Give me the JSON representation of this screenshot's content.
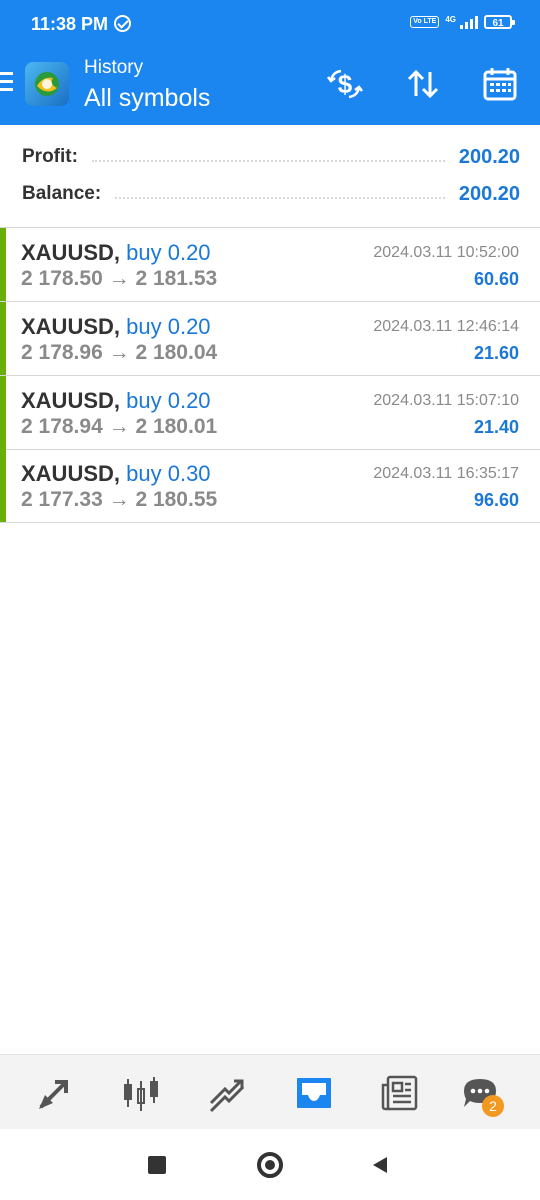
{
  "status_bar": {
    "time": "11:38 PM",
    "volte": "Vo LTE",
    "network": "4G",
    "battery": "61"
  },
  "header": {
    "subtitle": "History",
    "title": "All symbols"
  },
  "summary": {
    "profit_label": "Profit:",
    "profit_value": "200.20",
    "balance_label": "Balance:",
    "balance_value": "200.20"
  },
  "trades": [
    {
      "symbol": "XAUUSD,",
      "side": "buy 0.20",
      "open": "2 178.50",
      "arrow": "→",
      "close": "2 181.53",
      "time": "2024.03.11 10:52:00",
      "profit": "60.60"
    },
    {
      "symbol": "XAUUSD,",
      "side": "buy 0.20",
      "open": "2 178.96",
      "arrow": "→",
      "close": "2 180.04",
      "time": "2024.03.11 12:46:14",
      "profit": "21.60"
    },
    {
      "symbol": "XAUUSD,",
      "side": "buy 0.20",
      "open": "2 178.94",
      "arrow": "→",
      "close": "2 180.01",
      "time": "2024.03.11 15:07:10",
      "profit": "21.40"
    },
    {
      "symbol": "XAUUSD,",
      "side": "buy 0.30",
      "open": "2 177.33",
      "arrow": "→",
      "close": "2 180.55",
      "time": "2024.03.11 16:35:17",
      "profit": "96.60"
    }
  ],
  "bottom_nav": {
    "items": [
      "quotes-icon",
      "chart-icon",
      "trade-icon",
      "history-icon",
      "news-icon",
      "chat-icon"
    ],
    "active": "history-icon",
    "chat_badge": "2"
  },
  "colors": {
    "header_bg": "#1b86f0",
    "accent": "#1b78d8",
    "buy_bar": "#6aaf08",
    "badge": "#f39820"
  }
}
